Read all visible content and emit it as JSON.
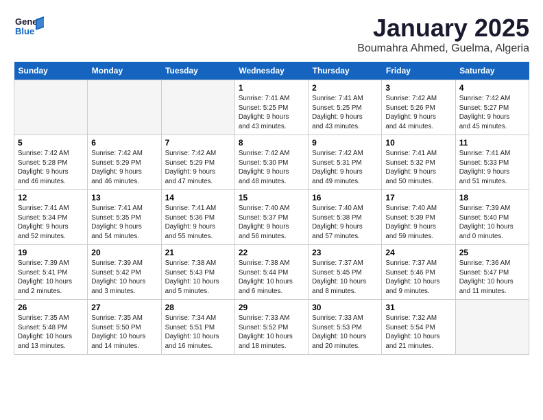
{
  "header": {
    "logo_general": "General",
    "logo_blue": "Blue",
    "month": "January 2025",
    "location": "Boumahra Ahmed, Guelma, Algeria"
  },
  "weekdays": [
    "Sunday",
    "Monday",
    "Tuesday",
    "Wednesday",
    "Thursday",
    "Friday",
    "Saturday"
  ],
  "weeks": [
    [
      {
        "day": "",
        "info": ""
      },
      {
        "day": "",
        "info": ""
      },
      {
        "day": "",
        "info": ""
      },
      {
        "day": "1",
        "info": "Sunrise: 7:41 AM\nSunset: 5:25 PM\nDaylight: 9 hours\nand 43 minutes."
      },
      {
        "day": "2",
        "info": "Sunrise: 7:41 AM\nSunset: 5:25 PM\nDaylight: 9 hours\nand 43 minutes."
      },
      {
        "day": "3",
        "info": "Sunrise: 7:42 AM\nSunset: 5:26 PM\nDaylight: 9 hours\nand 44 minutes."
      },
      {
        "day": "4",
        "info": "Sunrise: 7:42 AM\nSunset: 5:27 PM\nDaylight: 9 hours\nand 45 minutes."
      }
    ],
    [
      {
        "day": "5",
        "info": "Sunrise: 7:42 AM\nSunset: 5:28 PM\nDaylight: 9 hours\nand 46 minutes."
      },
      {
        "day": "6",
        "info": "Sunrise: 7:42 AM\nSunset: 5:29 PM\nDaylight: 9 hours\nand 46 minutes."
      },
      {
        "day": "7",
        "info": "Sunrise: 7:42 AM\nSunset: 5:29 PM\nDaylight: 9 hours\nand 47 minutes."
      },
      {
        "day": "8",
        "info": "Sunrise: 7:42 AM\nSunset: 5:30 PM\nDaylight: 9 hours\nand 48 minutes."
      },
      {
        "day": "9",
        "info": "Sunrise: 7:42 AM\nSunset: 5:31 PM\nDaylight: 9 hours\nand 49 minutes."
      },
      {
        "day": "10",
        "info": "Sunrise: 7:41 AM\nSunset: 5:32 PM\nDaylight: 9 hours\nand 50 minutes."
      },
      {
        "day": "11",
        "info": "Sunrise: 7:41 AM\nSunset: 5:33 PM\nDaylight: 9 hours\nand 51 minutes."
      }
    ],
    [
      {
        "day": "12",
        "info": "Sunrise: 7:41 AM\nSunset: 5:34 PM\nDaylight: 9 hours\nand 52 minutes."
      },
      {
        "day": "13",
        "info": "Sunrise: 7:41 AM\nSunset: 5:35 PM\nDaylight: 9 hours\nand 54 minutes."
      },
      {
        "day": "14",
        "info": "Sunrise: 7:41 AM\nSunset: 5:36 PM\nDaylight: 9 hours\nand 55 minutes."
      },
      {
        "day": "15",
        "info": "Sunrise: 7:40 AM\nSunset: 5:37 PM\nDaylight: 9 hours\nand 56 minutes."
      },
      {
        "day": "16",
        "info": "Sunrise: 7:40 AM\nSunset: 5:38 PM\nDaylight: 9 hours\nand 57 minutes."
      },
      {
        "day": "17",
        "info": "Sunrise: 7:40 AM\nSunset: 5:39 PM\nDaylight: 9 hours\nand 59 minutes."
      },
      {
        "day": "18",
        "info": "Sunrise: 7:39 AM\nSunset: 5:40 PM\nDaylight: 10 hours\nand 0 minutes."
      }
    ],
    [
      {
        "day": "19",
        "info": "Sunrise: 7:39 AM\nSunset: 5:41 PM\nDaylight: 10 hours\nand 2 minutes."
      },
      {
        "day": "20",
        "info": "Sunrise: 7:39 AM\nSunset: 5:42 PM\nDaylight: 10 hours\nand 3 minutes."
      },
      {
        "day": "21",
        "info": "Sunrise: 7:38 AM\nSunset: 5:43 PM\nDaylight: 10 hours\nand 5 minutes."
      },
      {
        "day": "22",
        "info": "Sunrise: 7:38 AM\nSunset: 5:44 PM\nDaylight: 10 hours\nand 6 minutes."
      },
      {
        "day": "23",
        "info": "Sunrise: 7:37 AM\nSunset: 5:45 PM\nDaylight: 10 hours\nand 8 minutes."
      },
      {
        "day": "24",
        "info": "Sunrise: 7:37 AM\nSunset: 5:46 PM\nDaylight: 10 hours\nand 9 minutes."
      },
      {
        "day": "25",
        "info": "Sunrise: 7:36 AM\nSunset: 5:47 PM\nDaylight: 10 hours\nand 11 minutes."
      }
    ],
    [
      {
        "day": "26",
        "info": "Sunrise: 7:35 AM\nSunset: 5:48 PM\nDaylight: 10 hours\nand 13 minutes."
      },
      {
        "day": "27",
        "info": "Sunrise: 7:35 AM\nSunset: 5:50 PM\nDaylight: 10 hours\nand 14 minutes."
      },
      {
        "day": "28",
        "info": "Sunrise: 7:34 AM\nSunset: 5:51 PM\nDaylight: 10 hours\nand 16 minutes."
      },
      {
        "day": "29",
        "info": "Sunrise: 7:33 AM\nSunset: 5:52 PM\nDaylight: 10 hours\nand 18 minutes."
      },
      {
        "day": "30",
        "info": "Sunrise: 7:33 AM\nSunset: 5:53 PM\nDaylight: 10 hours\nand 20 minutes."
      },
      {
        "day": "31",
        "info": "Sunrise: 7:32 AM\nSunset: 5:54 PM\nDaylight: 10 hours\nand 21 minutes."
      },
      {
        "day": "",
        "info": ""
      }
    ]
  ]
}
